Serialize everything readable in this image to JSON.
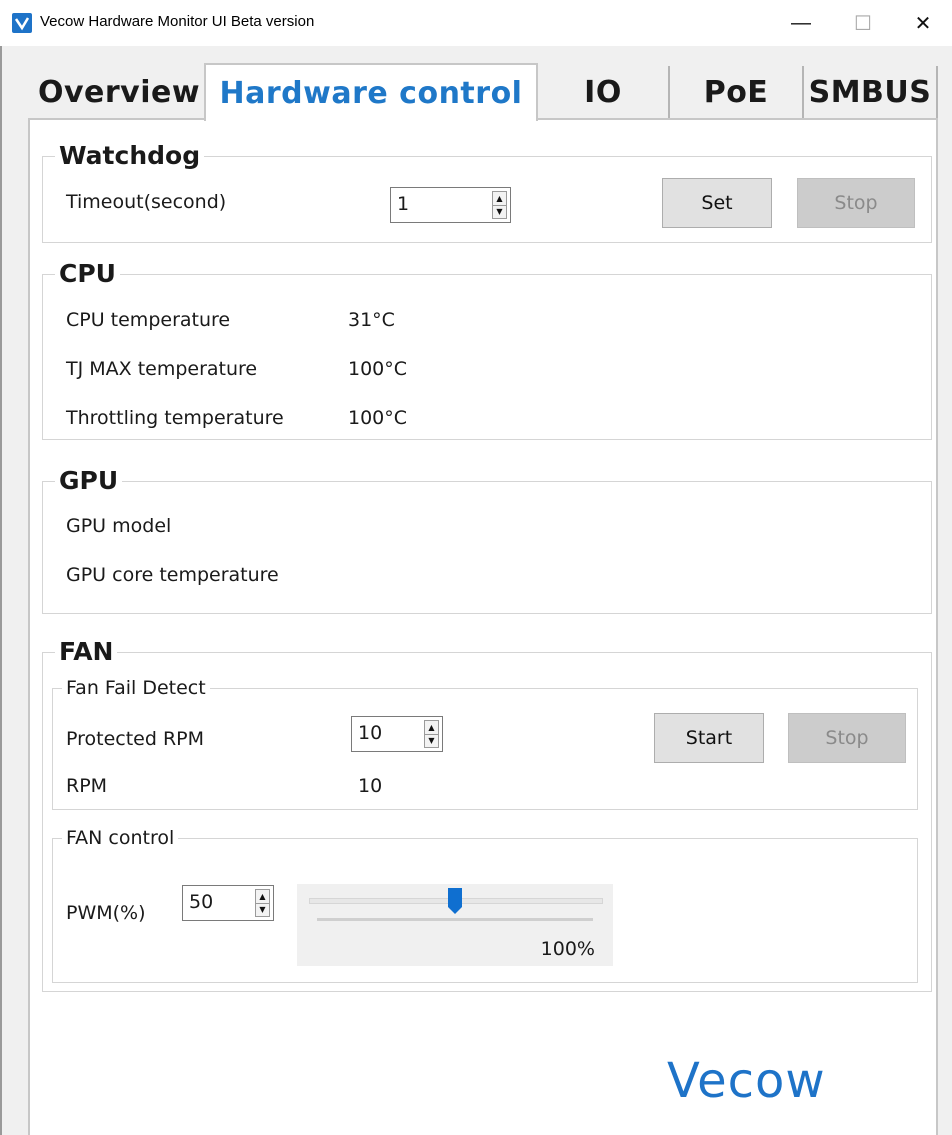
{
  "window": {
    "title": "Vecow Hardware Monitor UI Beta version",
    "icon": "check-logo-icon",
    "minimize_glyph": "—",
    "maximize_glyph": "☐",
    "close_glyph": "✕"
  },
  "tabs": [
    {
      "label": "Overview",
      "active": false
    },
    {
      "label": "Hardware control",
      "active": true
    },
    {
      "label": "IO",
      "active": false
    },
    {
      "label": "PoE",
      "active": false
    },
    {
      "label": "SMBUS",
      "active": false
    }
  ],
  "accent_color": "#1f78c8",
  "watchdog": {
    "title": "Watchdog",
    "timeout_label": "Timeout(second)",
    "timeout_value": "1",
    "set_label": "Set",
    "stop_label": "Stop"
  },
  "cpu": {
    "title": "CPU",
    "rows": [
      {
        "label": "CPU temperature",
        "value": "31°C"
      },
      {
        "label": "TJ MAX temperature",
        "value": "100°C"
      },
      {
        "label": "Throttling temperature",
        "value": "100°C"
      }
    ]
  },
  "gpu": {
    "title": "GPU",
    "model_label": "GPU model",
    "core_temp_label": "GPU core temperature"
  },
  "fan": {
    "title": "FAN",
    "fail_detect": {
      "title": "Fan Fail Detect",
      "protected_rpm_label": "Protected RPM",
      "protected_rpm_value": "10",
      "start_label": "Start",
      "stop_label": "Stop",
      "rpm_label": "RPM",
      "rpm_value": "10"
    },
    "control": {
      "title": "FAN control",
      "pwm_label": "PWM(%)",
      "pwm_value": "50",
      "slider_level_percent": 50,
      "slider_value_text": "100%"
    }
  },
  "logo_text": "Vecow"
}
